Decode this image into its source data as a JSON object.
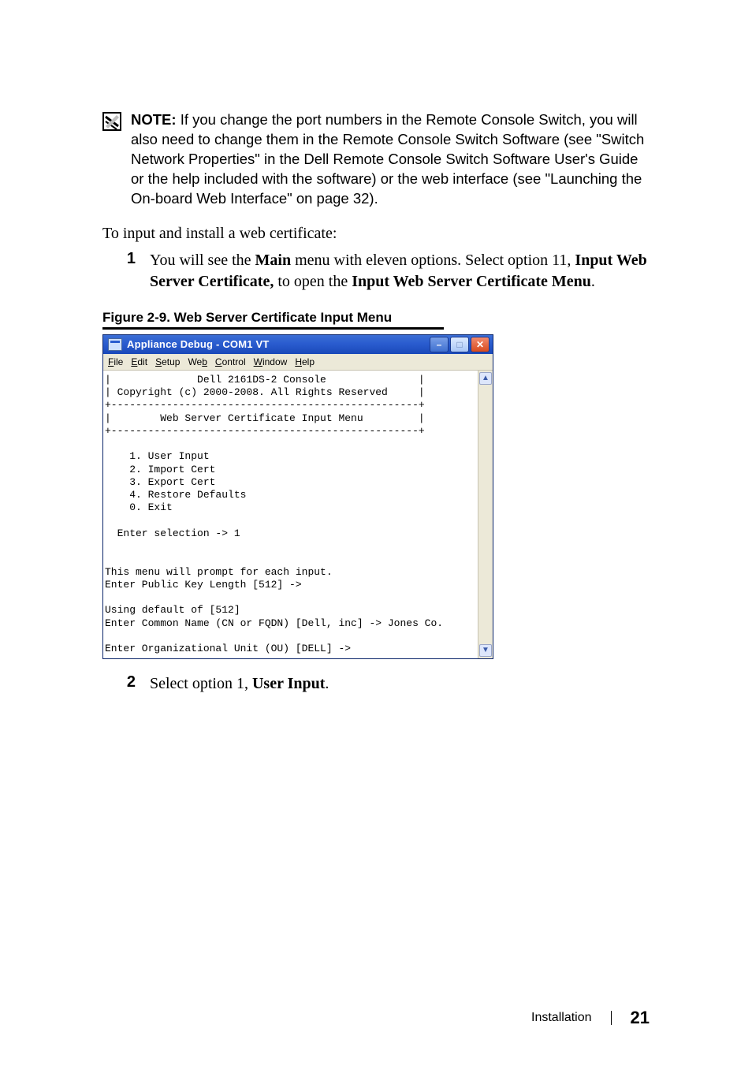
{
  "note": {
    "prefix": "NOTE:",
    "body": " If you change the port numbers in the Remote Console Switch, you will also need to change them in the Remote Console Switch Software (see \"Switch Network Properties\" in the Dell Remote Console Switch Software User's Guide or the help included with the software) or the web interface (see \"Launching the On-board Web Interface\" on page 32)."
  },
  "intro": "To input and install a web certificate:",
  "step1": {
    "num": "1",
    "pre": "You will see the ",
    "b1": "Main",
    "mid1": " menu with eleven options. Select option 11, ",
    "b2": "Input Web Server Certificate,",
    "mid2": " to open the ",
    "b3": "Input Web Server Certificate Menu",
    "post": "."
  },
  "figure": {
    "label": "Figure 2-9.    Web Server Certificate Input Menu"
  },
  "appwin": {
    "title": "Appliance Debug - COM1 VT",
    "menus": {
      "file_u": "F",
      "file_r": "ile",
      "edit_u": "E",
      "edit_r": "dit",
      "setup_u": "S",
      "setup_r": "etup",
      "web_pre": "We",
      "web_u": "b",
      "web_r": "",
      "control_u": "C",
      "control_r": "ontrol",
      "window_u": "W",
      "window_r": "indow",
      "help_u": "H",
      "help_r": "elp"
    },
    "terminal": "|              Dell 2161DS-2 Console               |\n| Copyright (c) 2000-2008. All Rights Reserved     |\n+--------------------------------------------------+\n|        Web Server Certificate Input Menu         |\n+--------------------------------------------------+\n\n    1. User Input\n    2. Import Cert\n    3. Export Cert\n    4. Restore Defaults\n    0. Exit\n\n  Enter selection -> 1\n\n\nThis menu will prompt for each input.\nEnter Public Key Length [512] ->\n\nUsing default of [512]\nEnter Common Name (CN or FQDN) [Dell, inc] -> Jones Co.\n\nEnter Organizational Unit (OU) [DELL] ->"
  },
  "step2": {
    "num": "2",
    "pre": "Select option 1, ",
    "b1": "User Input",
    "post": "."
  },
  "footer": {
    "section": "Installation",
    "page": "21"
  }
}
